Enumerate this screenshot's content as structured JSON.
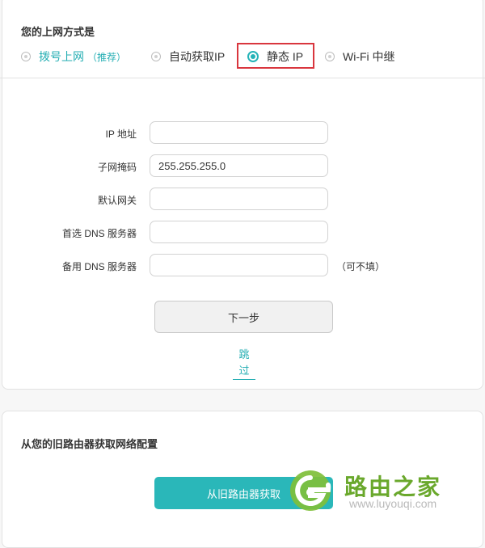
{
  "mode_section": {
    "title": "您的上网方式是",
    "options": [
      {
        "label": "拨号上网",
        "note": "（推荐）",
        "selected": false
      },
      {
        "label": "自动获取IP",
        "selected": false
      },
      {
        "label": "静态 IP",
        "selected": true
      },
      {
        "label": "Wi-Fi 中继",
        "selected": false
      }
    ]
  },
  "form": {
    "fields": [
      {
        "label": "IP 地址",
        "value": ""
      },
      {
        "label": "子网掩码",
        "value": "255.255.255.0"
      },
      {
        "label": "默认网关",
        "value": ""
      },
      {
        "label": "首选 DNS 服务器",
        "value": ""
      },
      {
        "label": "备用 DNS 服务器",
        "value": "",
        "note": "（可不填）"
      }
    ],
    "next_label": "下一步",
    "skip_label_line1": "跳",
    "skip_label_line2": "过"
  },
  "old_router": {
    "title": "从您的旧路由器获取网络配置",
    "button_label": "从旧路由器获取"
  },
  "watermark": {
    "brand": "路由之家",
    "url": "www.luyouqi.com"
  },
  "colors": {
    "accent": "#24b3b7",
    "highlight": "#d9363e",
    "watermark_green": "#6aa82c"
  }
}
